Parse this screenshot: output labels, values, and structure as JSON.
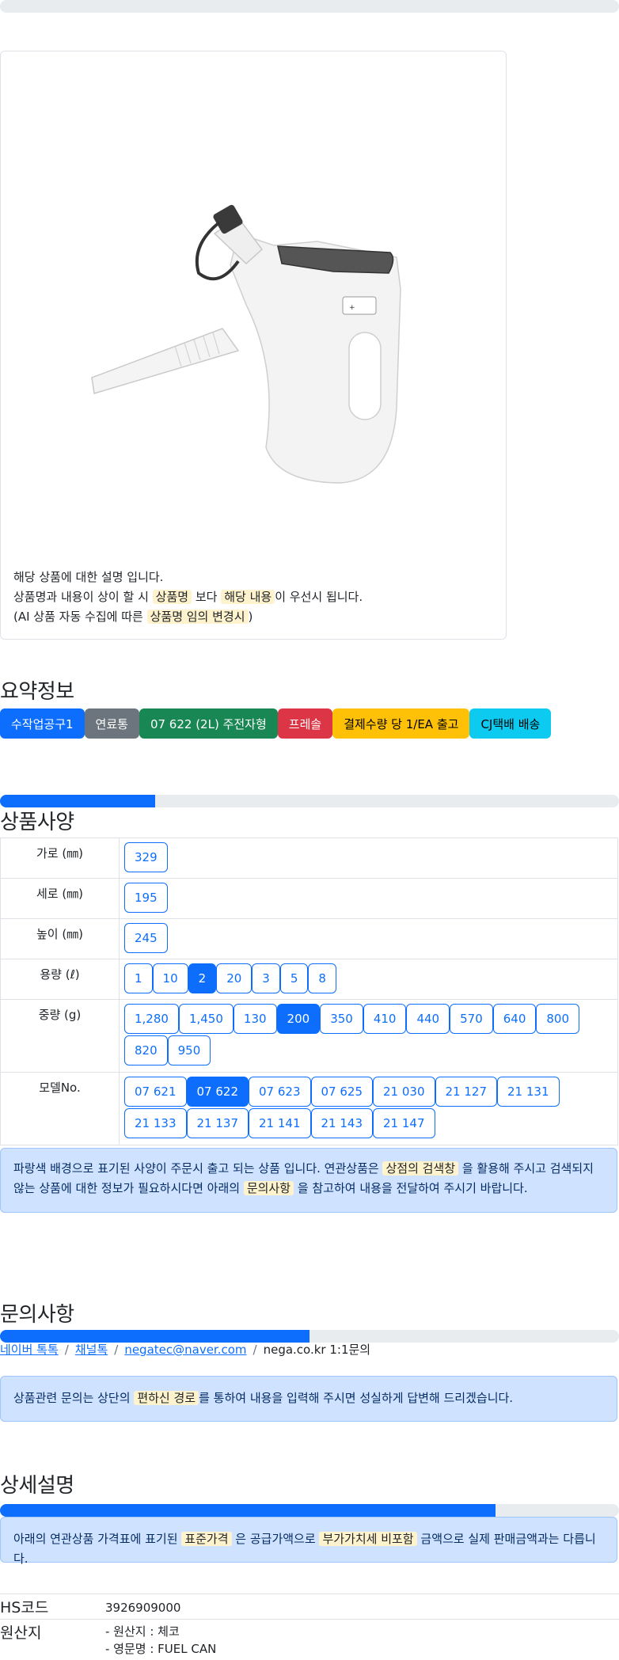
{
  "description_card": {
    "line1": "해당 상품에 대한 설명 입니다.",
    "line2_a": "상품명과 내용이 상이 할 시",
    "line2_b": "상품명",
    "line2_c": "보다",
    "line2_d": "해당 내용",
    "line2_e": "이 우선시 됩니다.",
    "line3_a": "(AI 상품 자동 수집에 따른",
    "line3_b": "상품명 임의 변경시",
    "line3_c": ")"
  },
  "summary": {
    "title": "요약정보",
    "badges": [
      {
        "label": "수작업공구1",
        "color": "#0d6efd",
        "text_color": "#ffffff"
      },
      {
        "label": "연료통",
        "color": "#6c757d",
        "text_color": "#ffffff"
      },
      {
        "label": "07 622 (2L) 주전자형",
        "color": "#198754",
        "text_color": "#ffffff"
      },
      {
        "label": "프레솔",
        "color": "#dc3545",
        "text_color": "#ffffff"
      },
      {
        "label": "결제수량 당 1/EA 출고",
        "color": "#ffc107",
        "text_color": "#000000"
      },
      {
        "label": "CJ택배 배송",
        "color": "#0dcaf0",
        "text_color": "#000000"
      }
    ]
  },
  "specs": {
    "title": "상품사양",
    "progress": 0.25,
    "rows": [
      {
        "label": "가로 (㎜)",
        "options": [
          {
            "v": "329",
            "sel": false
          }
        ]
      },
      {
        "label": "세로 (㎜)",
        "options": [
          {
            "v": "195",
            "sel": false
          }
        ]
      },
      {
        "label": "높이 (㎜)",
        "options": [
          {
            "v": "245",
            "sel": false
          }
        ]
      },
      {
        "label": "용량 (ℓ)",
        "options": [
          {
            "v": "1",
            "sel": false
          },
          {
            "v": "10",
            "sel": false
          },
          {
            "v": "2",
            "sel": true
          },
          {
            "v": "20",
            "sel": false
          },
          {
            "v": "3",
            "sel": false
          },
          {
            "v": "5",
            "sel": false
          },
          {
            "v": "8",
            "sel": false
          }
        ]
      },
      {
        "label": "중량 (g)",
        "options": [
          {
            "v": "1,280",
            "sel": false
          },
          {
            "v": "1,450",
            "sel": false
          },
          {
            "v": "130",
            "sel": false
          },
          {
            "v": "200",
            "sel": true
          },
          {
            "v": "350",
            "sel": false
          },
          {
            "v": "410",
            "sel": false
          },
          {
            "v": "440",
            "sel": false
          },
          {
            "v": "570",
            "sel": false
          },
          {
            "v": "640",
            "sel": false
          },
          {
            "v": "800",
            "sel": false
          },
          {
            "v": "820",
            "sel": false
          },
          {
            "v": "950",
            "sel": false
          }
        ]
      },
      {
        "label": "모델No.",
        "options": [
          {
            "v": "07 621",
            "sel": false
          },
          {
            "v": "07 622",
            "sel": true
          },
          {
            "v": "07 623",
            "sel": false
          },
          {
            "v": "07 625",
            "sel": false
          },
          {
            "v": "21 030",
            "sel": false
          },
          {
            "v": "21 127",
            "sel": false
          },
          {
            "v": "21 131",
            "sel": false
          },
          {
            "v": "21 133",
            "sel": false
          },
          {
            "v": "21 137",
            "sel": false
          },
          {
            "v": "21 141",
            "sel": false
          },
          {
            "v": "21 143",
            "sel": false
          },
          {
            "v": "21 147",
            "sel": false
          }
        ]
      }
    ],
    "notice_a": "파랑색 배경으로 표기된 사양이 주문시 출고 되는 상품 입니다. 연관상품은",
    "notice_b": "상점의 검색창",
    "notice_c": "을 활용해 주시고 검색되지 않는 상품에 대한 정보가 필요하시다면 아래의",
    "notice_d": "문의사항",
    "notice_e": "을 참고하여 내용을 전달하여 주시기 바랍니다."
  },
  "inquiry": {
    "title": "문의사항",
    "progress": 0.5,
    "links": [
      "네이버 톡톡",
      "채널톡",
      "negatec@naver.com"
    ],
    "plain": "nega.co.kr 1:1문의",
    "notice_a": "상품관련 문의는 상단의",
    "notice_b": "편하신 경로",
    "notice_c": "를 통하여 내용을 입력해 주시면 성실하게 답변해 드리겠습니다."
  },
  "details": {
    "title": "상세설명",
    "progress": 0.8,
    "notice_a": "아래의 연관상품 가격표에 표기된",
    "notice_b": "표준가격",
    "notice_c": "은 공급가액으로",
    "notice_d": "부가가치세 비포함",
    "notice_e": "금액으로 실제 판매금액과는 다릅니다."
  },
  "info": {
    "hs_label": "HS코드",
    "hs_value": "3926909000",
    "origin_label": "원산지",
    "origin_line1": "- 원산지 : 체코",
    "origin_line2": "- 영문명 : FUEL CAN"
  }
}
